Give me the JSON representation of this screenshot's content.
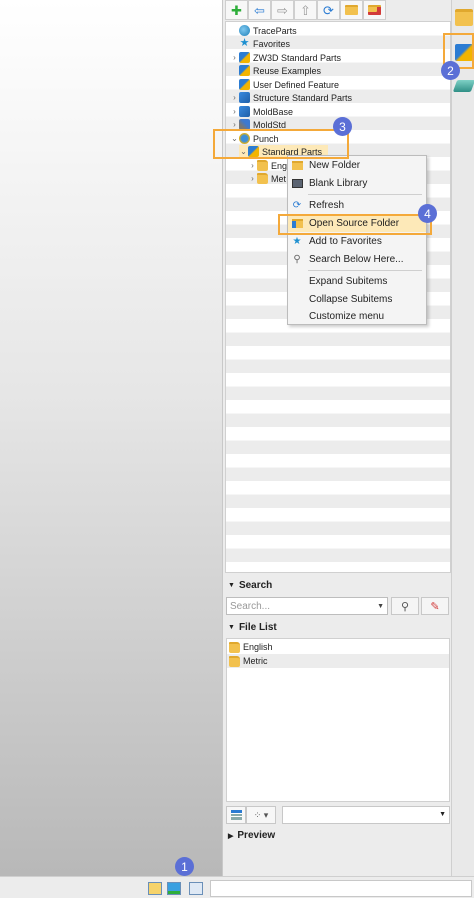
{
  "toolbar": {
    "buttons": [
      {
        "icon": "add-icon",
        "glyph": "✚",
        "color": "#2eae3a"
      },
      {
        "icon": "back-arrow-icon",
        "glyph": "⇦",
        "color": "#2b7cd3"
      },
      {
        "icon": "forward-arrow-icon",
        "glyph": "⇨",
        "color": "#9a9a9a"
      },
      {
        "icon": "up-arrow-icon",
        "glyph": "⇧",
        "color": "#9a9a9a"
      },
      {
        "icon": "refresh-icon",
        "glyph": "⟳",
        "color": "#2b7cd3"
      },
      {
        "icon": "open-folder-icon",
        "glyph": "📂",
        "color": "#e0a82e"
      },
      {
        "icon": "remove-folder-icon",
        "glyph": "📁",
        "color": "#d23a3a"
      }
    ]
  },
  "tree": {
    "items": [
      {
        "label": "TraceParts",
        "icon": "globe-icon"
      },
      {
        "label": "Favorites",
        "icon": "star-icon"
      },
      {
        "label": "ZW3D Standard Parts",
        "icon": "parts-icon"
      },
      {
        "label": "Reuse Examples",
        "icon": "parts-icon"
      },
      {
        "label": "User Defined Feature",
        "icon": "parts-icon"
      },
      {
        "label": "Structure Standard Parts",
        "icon": "folder-blue-icon"
      },
      {
        "label": "MoldBase",
        "icon": "folder-blue-icon"
      },
      {
        "label": "MoldStd",
        "icon": "pin-icon"
      },
      {
        "label": "Punch",
        "icon": "punch-icon"
      },
      {
        "label": "Standard Parts",
        "icon": "parts-icon"
      },
      {
        "label": "Eng",
        "icon": "folder-icon"
      },
      {
        "label": "Met",
        "icon": "folder-icon"
      }
    ]
  },
  "context_menu": {
    "items": [
      {
        "label": "New Folder",
        "icon": "new-folder-icon"
      },
      {
        "label": "Blank Library",
        "icon": "blank-library-icon"
      },
      {
        "label": "Refresh",
        "icon": "refresh-icon"
      },
      {
        "label": "Open Source Folder",
        "icon": "open-source-folder-icon"
      },
      {
        "label": "Add to Favorites",
        "icon": "star-icon"
      },
      {
        "label": "Search Below Here...",
        "icon": "magnifier-icon"
      },
      {
        "label": "Expand Subitems",
        "icon": ""
      },
      {
        "label": "Collapse Subitems",
        "icon": ""
      },
      {
        "label": "Customize menu",
        "icon": ""
      }
    ]
  },
  "search": {
    "header": "Search",
    "placeholder": "Search..."
  },
  "file_list": {
    "header": "File List",
    "items": [
      "English",
      "Metric"
    ]
  },
  "preview": {
    "header": "Preview"
  },
  "badges": [
    "1",
    "2",
    "3",
    "4"
  ],
  "colors": {
    "highlight": "#f4a93a",
    "badge": "#5b6fd6",
    "menu_hover": "#fde9b8"
  }
}
